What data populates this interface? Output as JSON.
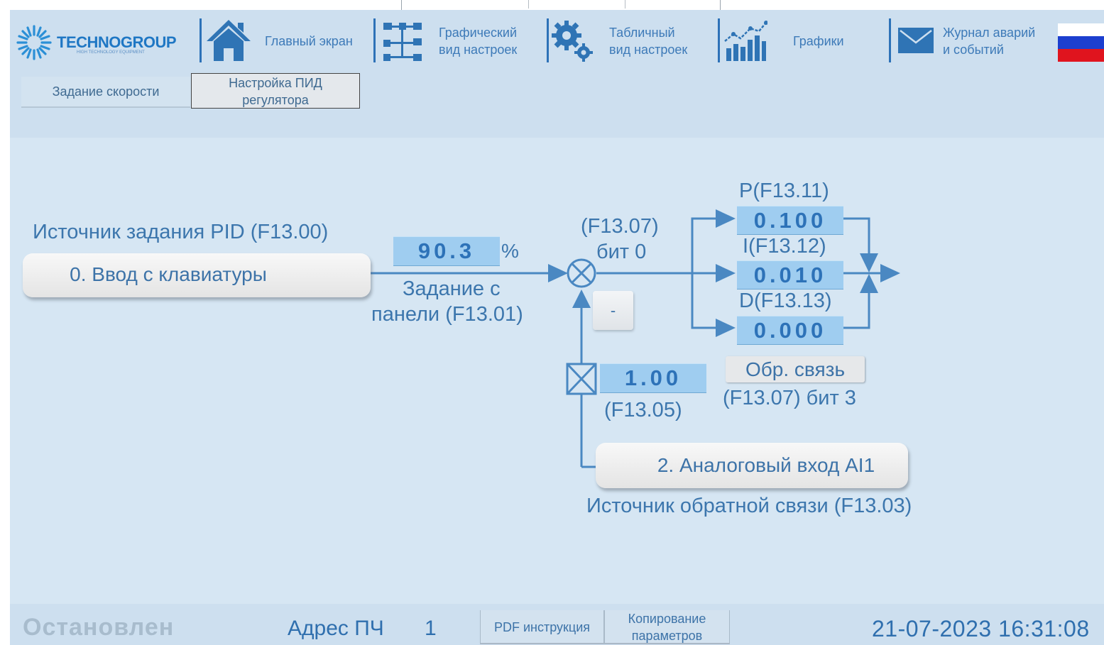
{
  "header": {
    "logo_text": "TECHNOGROUP",
    "logo_subtitle": "HIGH TECHNOLOGY EQUIPMENT",
    "nav": {
      "home": "Главный экран",
      "graphic_line1": "Графический",
      "graphic_line2": "вид настроек",
      "table_line1": "Табличный",
      "table_line2": "вид настроек",
      "charts": "Графики",
      "log_line1": "Журнал аварий",
      "log_line2": "и событий"
    },
    "language_flag": "ru"
  },
  "tabs": {
    "speed": "Задание скорости",
    "pid_line1": "Настройка ПИД",
    "pid_line2": "регулятора"
  },
  "diagram": {
    "setpoint_source_label": "Источник задания PID (F13.00)",
    "setpoint_source_value": "0. Ввод с клавиатуры",
    "panel_value": "90.3",
    "panel_unit": "%",
    "panel_label_line1": "Задание с",
    "panel_label_line2": "панели (F13.01)",
    "sum_param_line1": "(F13.07)",
    "sum_param_line2": "бит 0",
    "minus_label": "-",
    "p_label": "P(F13.11)",
    "p_value": "0.100",
    "i_label": "I(F13.12)",
    "i_value": "0.010",
    "d_label": "D(F13.13)",
    "d_value": "0.000",
    "feedback_button": "Обр. связь",
    "feedback_param": "(F13.07) бит 3",
    "gain_value": "1.00",
    "gain_param": "(F13.05)",
    "feedback_source_value": "2. Аналоговый вход AI1",
    "feedback_source_label": "Источник обратной связи (F13.03)"
  },
  "footer": {
    "status": "Остановлен",
    "address_label": "Адрес ПЧ",
    "address_value": "1",
    "pdf_button": "PDF инструкция",
    "copy_line1": "Копирование",
    "copy_line2": "параметров",
    "datetime": "21-07-2023 16:31:08"
  },
  "colors": {
    "background": "#d6e6f3",
    "header": "#cddfef",
    "accent": "#2d72b8",
    "value_box": "#9fcdf0",
    "status_inactive": "#a8bccd"
  }
}
